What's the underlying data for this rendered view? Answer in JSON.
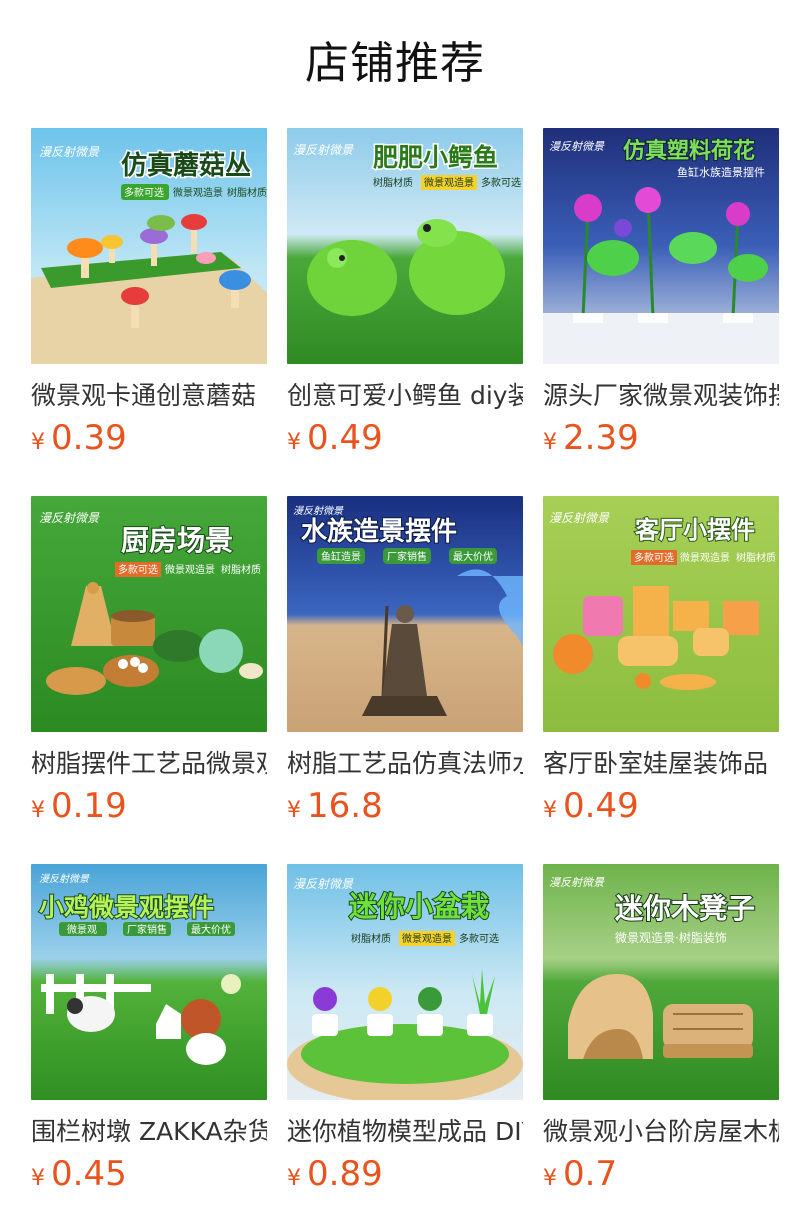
{
  "section_title": "店铺推荐",
  "products": [
    {
      "name": "微景观卡通创意蘑菇",
      "currency": "¥",
      "price": "0.39",
      "image": {
        "brand": "漫反射微景",
        "headline": "仿真蘑菇丛",
        "tags": [
          "多款可选",
          "微景观造景",
          "树脂材质"
        ],
        "palette": {
          "top": "#5fb3e0",
          "bottom": "#2f8f2a",
          "accent": "#ff8c1a"
        }
      }
    },
    {
      "name": "创意可爱小鳄鱼 diy装",
      "currency": "¥",
      "price": "0.49",
      "image": {
        "brand": "漫反射微景",
        "headline": "肥肥小鳄鱼",
        "tags": [
          "树脂材质",
          "微景观造景",
          "多款可选"
        ],
        "palette": {
          "top": "#7fc4e8",
          "bottom": "#3a9a2e",
          "accent": "#7ddc3a"
        }
      }
    },
    {
      "name": "源头厂家微景观装饰摆",
      "currency": "¥",
      "price": "2.39",
      "image": {
        "brand": "漫反射微景",
        "headline": "仿真塑料荷花",
        "tags": [
          "鱼缸水族造景摆件"
        ],
        "palette": {
          "top": "#253a8a",
          "bottom": "#dfe6ee",
          "accent": "#d63cc8"
        }
      }
    },
    {
      "name": "树脂摆件工艺品微景观",
      "currency": "¥",
      "price": "0.19",
      "image": {
        "brand": "漫反射微景",
        "headline": "厨房场景",
        "tags": [
          "多款可选",
          "微景观造景",
          "树脂材质"
        ],
        "palette": {
          "top": "#3aa12f",
          "bottom": "#2c8a24",
          "accent": "#e2b065"
        }
      }
    },
    {
      "name": "树脂工艺品仿真法师水",
      "currency": "¥",
      "price": "16.8",
      "image": {
        "brand": "漫反射微景",
        "headline": "水族造景摆件",
        "tags": [
          "鱼缸造景",
          "厂家销售",
          "最大价优"
        ],
        "palette": {
          "top": "#1f3a8a",
          "bottom": "#d9b890",
          "accent": "#6fb8ff"
        }
      }
    },
    {
      "name": "客厅卧室娃屋装饰品",
      "currency": "¥",
      "price": "0.49",
      "image": {
        "brand": "漫反射微景",
        "headline": "客厅小摆件",
        "tags": [
          "多款可选",
          "微景观造景",
          "树脂材质"
        ],
        "palette": {
          "top": "#9cc94a",
          "bottom": "#8abd3c",
          "accent": "#f6a04a"
        }
      }
    },
    {
      "name": "围栏树墩 ZAKKA杂货",
      "currency": "¥",
      "price": "0.45",
      "image": {
        "brand": "漫反射微景",
        "headline": "小鸡微景观摆件",
        "tags": [
          "微景观",
          "厂家销售",
          "最大价优"
        ],
        "palette": {
          "top": "#4aa4d8",
          "bottom": "#3a9b2a",
          "accent": "#ffffff"
        }
      }
    },
    {
      "name": "迷你植物模型成品 DIY",
      "currency": "¥",
      "price": "0.89",
      "image": {
        "brand": "漫反射微景",
        "headline": "迷你小盆栽",
        "tags": [
          "树脂材质",
          "微景观造景",
          "多款可选"
        ],
        "palette": {
          "top": "#6fc0e6",
          "bottom": "#e9d2a8",
          "accent": "#c43ad6"
        }
      }
    },
    {
      "name": "微景观小台阶房屋木桩",
      "currency": "¥",
      "price": "0.7",
      "image": {
        "brand": "漫反射微景",
        "headline": "迷你木凳子",
        "tags": [
          "微景观造景·树脂装饰"
        ],
        "palette": {
          "top": "#6eb34a",
          "bottom": "#3f9a2a",
          "accent": "#e6c28a"
        }
      }
    }
  ]
}
